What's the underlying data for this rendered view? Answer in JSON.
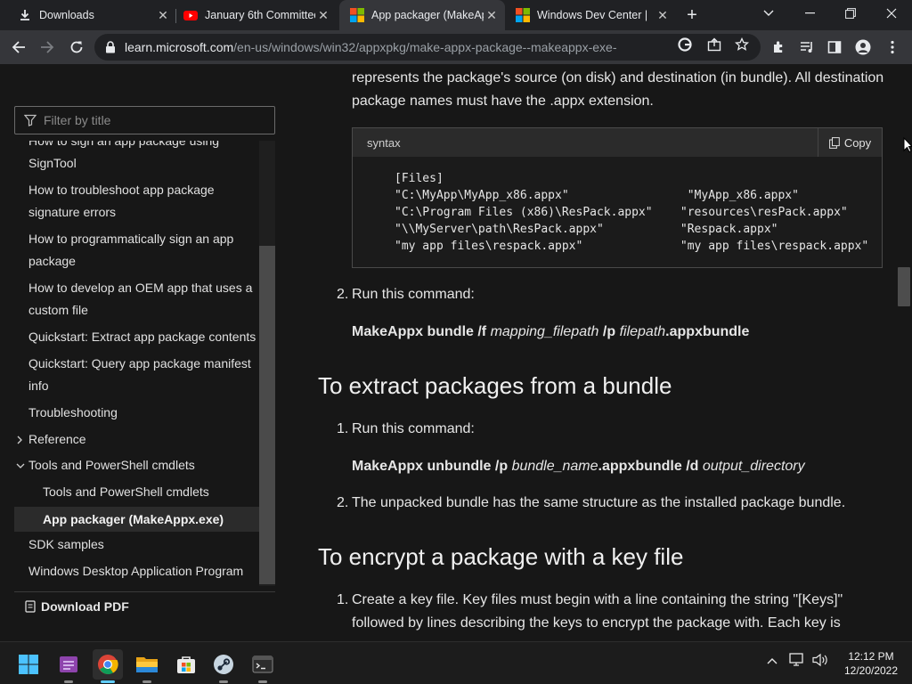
{
  "browser": {
    "tabs": [
      {
        "title": "Downloads",
        "icon": "download-icon"
      },
      {
        "title": "January 6th Committee",
        "icon": "youtube-icon"
      },
      {
        "title": "App packager (MakeAp",
        "icon": "microsoft-icon"
      },
      {
        "title": "Windows Dev Center |",
        "icon": "microsoft-icon"
      }
    ],
    "url_host": "learn.microsoft.com",
    "url_path": "/en-us/windows/win32/appxpkg/make-appx-package--makeappx-exe-"
  },
  "sidebar": {
    "filter_placeholder": "Filter by title",
    "items": [
      {
        "label": "How to sign an app package using",
        "type": "item"
      },
      {
        "label": "SignTool",
        "type": "cont"
      },
      {
        "label": "How to troubleshoot app package",
        "type": "item"
      },
      {
        "label": "signature errors",
        "type": "cont"
      },
      {
        "label": "How to programmatically sign an app",
        "type": "item"
      },
      {
        "label": "package",
        "type": "cont"
      },
      {
        "label": "How to develop an OEM app that uses a",
        "type": "item"
      },
      {
        "label": "custom file",
        "type": "cont"
      },
      {
        "label": "Quickstart: Extract app package contents",
        "type": "item"
      },
      {
        "label": "Quickstart: Query app package manifest",
        "type": "item"
      },
      {
        "label": "info",
        "type": "cont"
      },
      {
        "label": "Troubleshooting",
        "type": "item"
      },
      {
        "label": "Reference",
        "type": "collapsed"
      },
      {
        "label": "Tools and PowerShell cmdlets",
        "type": "expanded"
      },
      {
        "label": "Tools and PowerShell cmdlets",
        "type": "sub"
      },
      {
        "label": "App packager (MakeAppx.exe)",
        "type": "sub-active"
      },
      {
        "label": "SDK samples",
        "type": "item"
      },
      {
        "label": "Windows Desktop Application Program",
        "type": "item"
      }
    ],
    "download_pdf": "Download PDF"
  },
  "content": {
    "intro_line1": "represents the package's source (on disk) and destination (in bundle). All destination",
    "intro_line2": "package names must have the .appx extension.",
    "code": {
      "lang": "syntax",
      "copy_label": "Copy",
      "text": "[Files]\n\"C:\\MyApp\\MyApp_x86.appx\"                 \"MyApp_x86.appx\"\n\"C:\\Program Files (x86)\\ResPack.appx\"    \"resources\\resPack.appx\"\n\"\\\\MyServer\\path\\ResPack.appx\"           \"Respack.appx\"\n\"my app files\\respack.appx\"              \"my app files\\respack.appx\""
    },
    "step2_num": "2.",
    "step2_text": "Run this command:",
    "cmd1": {
      "a": "MakeAppx bundle /f ",
      "b": "mapping_filepath",
      "c": " /p ",
      "d": "filepath",
      "e": ".appxbundle"
    },
    "h_extract": "To extract packages from a bundle",
    "ex1_num": "1.",
    "ex1_text": "Run this command:",
    "cmd2": {
      "a": "MakeAppx unbundle /p ",
      "b": "bundle_name",
      "c": ".appxbundle /d ",
      "d": "output_directory"
    },
    "ex2_num": "2.",
    "ex2_text": "The unpacked bundle has the same structure as the installed package bundle.",
    "h_encrypt": "To encrypt a package with a key file",
    "en1_num": "1.",
    "en1_line1": "Create a key file. Key files must begin with a line containing the string \"[Keys]\"",
    "en1_line2": "followed by lines describing the keys to encrypt the package with. Each key is"
  },
  "taskbar": {
    "time": "12:12 PM",
    "date": "12/20/2022"
  }
}
